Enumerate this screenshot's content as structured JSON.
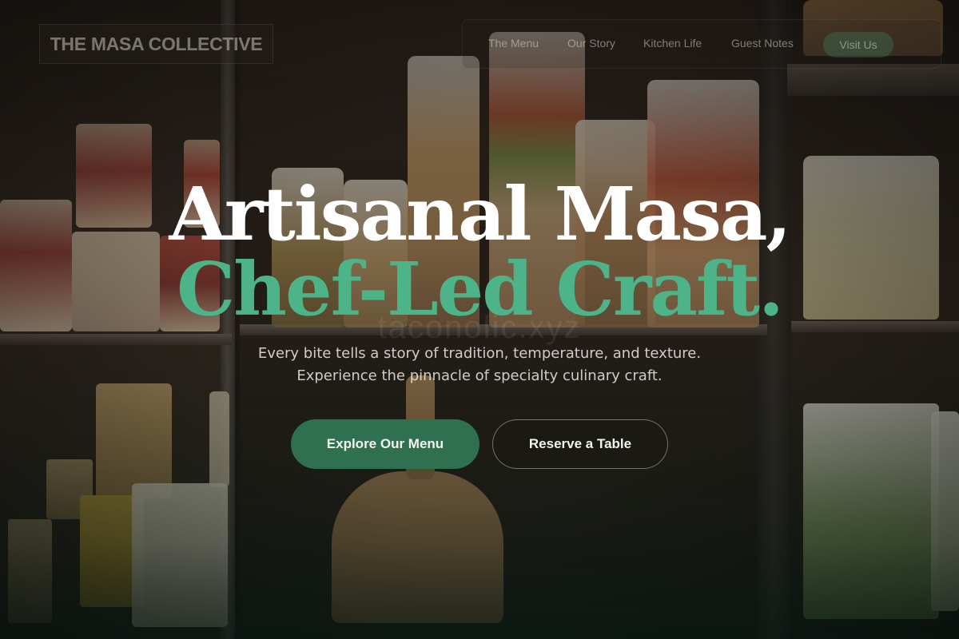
{
  "brand": {
    "logo_text": "THE MASA COLLECTIVE"
  },
  "nav": {
    "items": [
      {
        "label": "The Menu"
      },
      {
        "label": "Our Story"
      },
      {
        "label": "Kitchen Life"
      },
      {
        "label": "Guest Notes"
      }
    ],
    "cta_label": "Visit Us"
  },
  "hero": {
    "headline_line1": "Artisanal Masa,",
    "headline_line2": "Chef-Led Craft.",
    "watermark": "taconolic.xyz",
    "subtitle_line1": "Every bite tells a story of tradition, temperature, and texture.",
    "subtitle_line2": "Experience the pinnacle of specialty culinary craft.",
    "primary_button": "Explore Our Menu",
    "secondary_button": "Reserve a Table"
  },
  "colors": {
    "accent": "#4db48a",
    "primary_button": "#2f7050",
    "headline": "#ffffff"
  }
}
